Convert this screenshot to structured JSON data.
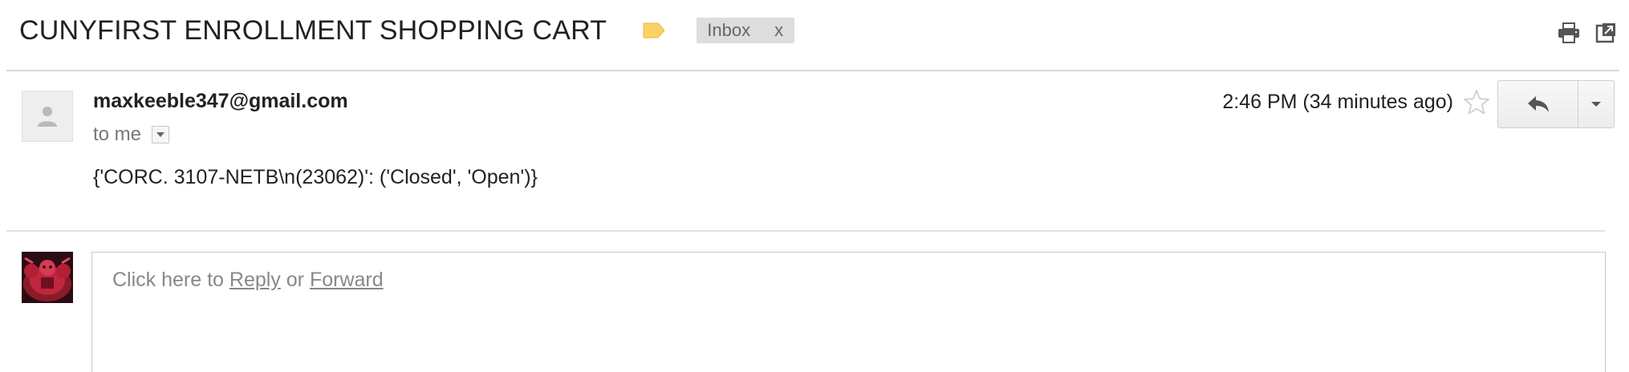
{
  "thread": {
    "subject": "CUNYFIRST ENROLLMENT SHOPPING CART",
    "label_icon": "label-tag-icon",
    "label_color": "#fad165",
    "inbox_chip": {
      "label": "Inbox",
      "remove": "x"
    },
    "toolbar_icons": [
      "print-icon",
      "open-in-new-window-icon"
    ]
  },
  "message": {
    "sender_email": "maxkeeble347@gmail.com",
    "recipient": "to me",
    "timestamp": "2:46 PM (34 minutes ago)",
    "star_icon": "star-icon",
    "reply_icon": "reply-icon",
    "more_icon": "dropdown-arrow-icon",
    "body": "{'CORC. 3107-NETB\\n(23062)': ('Closed', 'Open')}"
  },
  "reply_area": {
    "prompt_prefix": "Click here to ",
    "reply_link": "Reply",
    "or_text": " or ",
    "forward_link": "Forward"
  },
  "colors": {
    "chip_bg": "#dddddd",
    "divider": "#d8d8d8",
    "muted_text": "#888888"
  }
}
